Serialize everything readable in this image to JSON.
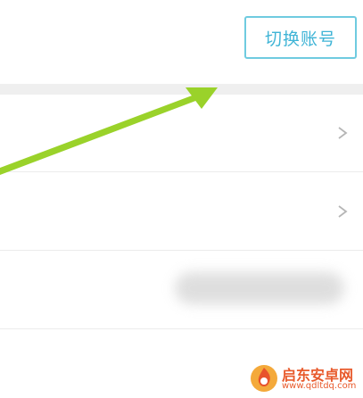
{
  "header": {
    "switch_account_label": "切换账号"
  },
  "colors": {
    "button_border": "#6fcbe0",
    "button_text": "#3fb4d6",
    "arrow": "#9ad22a",
    "separator": "#efefef",
    "chevron": "#b5b5b5",
    "watermark": "#e85a2c"
  },
  "icons": {
    "row_chevron": "chevron-right-icon",
    "annotation": "arrow-annotation",
    "watermark_logo": "flame-logo-icon"
  },
  "watermark": {
    "title": "启东安卓网",
    "url": "www.qdltdq.com"
  }
}
